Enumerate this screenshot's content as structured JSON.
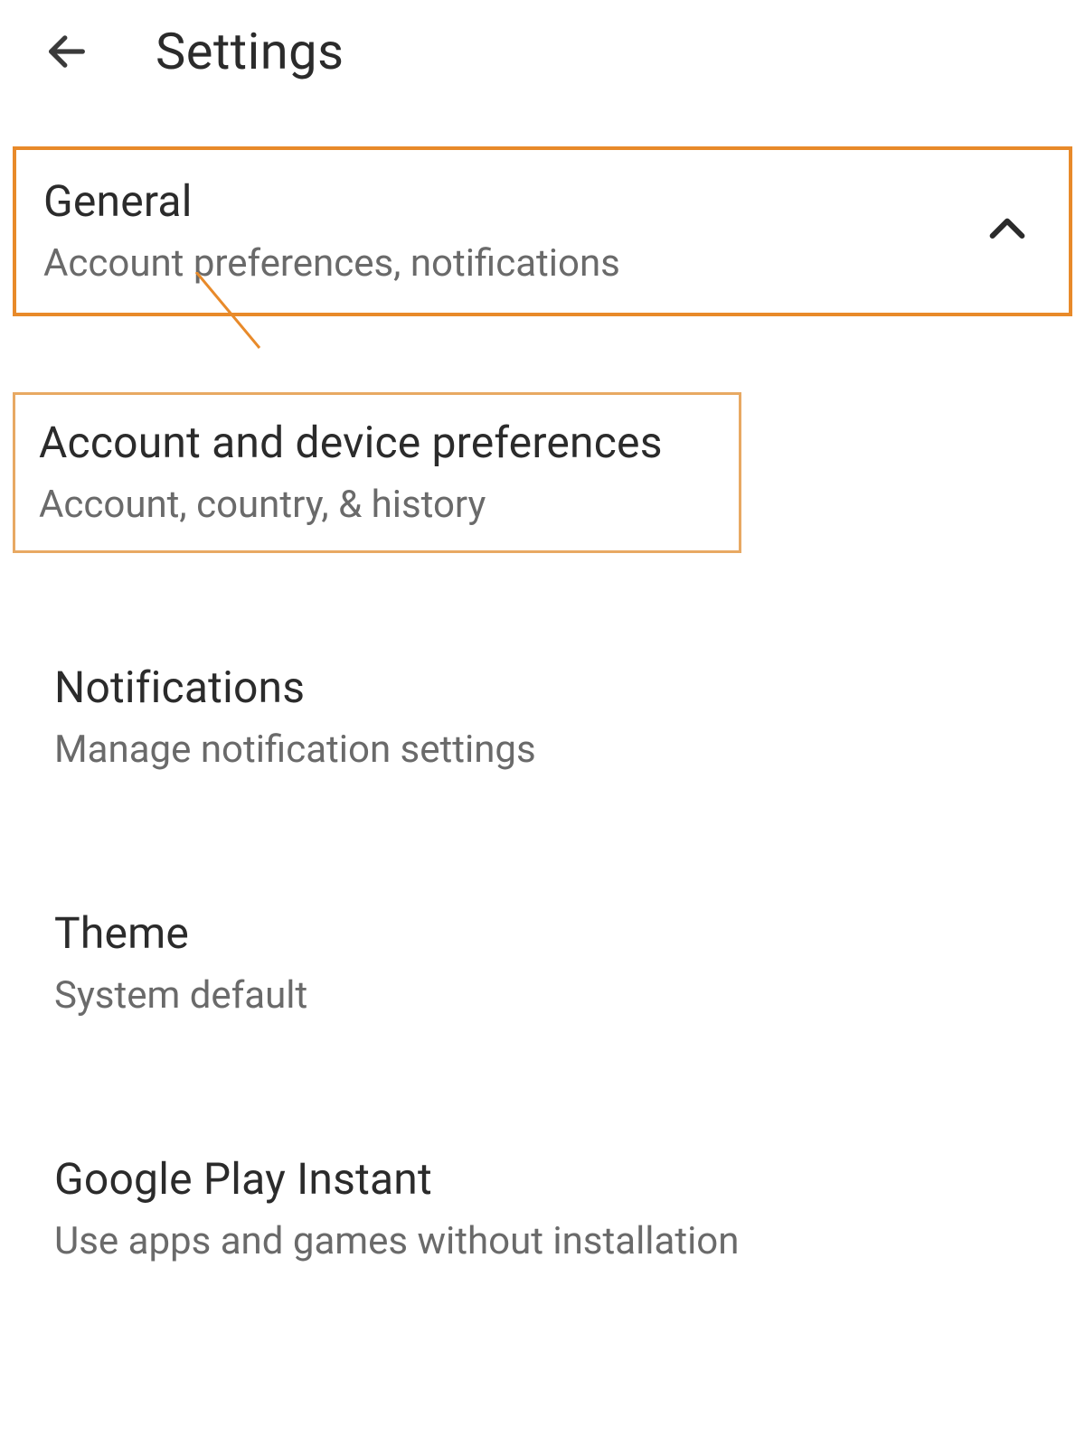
{
  "header": {
    "title": "Settings"
  },
  "items": {
    "general": {
      "title": "General",
      "subtitle": "Account preferences, notifications"
    },
    "account_device": {
      "title": "Account and device preferences",
      "subtitle": "Account, country, & history"
    },
    "notifications": {
      "title": "Notifications",
      "subtitle": "Manage notification settings"
    },
    "theme": {
      "title": "Theme",
      "subtitle": "System default"
    },
    "play_instant": {
      "title": "Google Play Instant",
      "subtitle": "Use apps and games without installation"
    }
  },
  "highlight_color": "#e88a2a"
}
